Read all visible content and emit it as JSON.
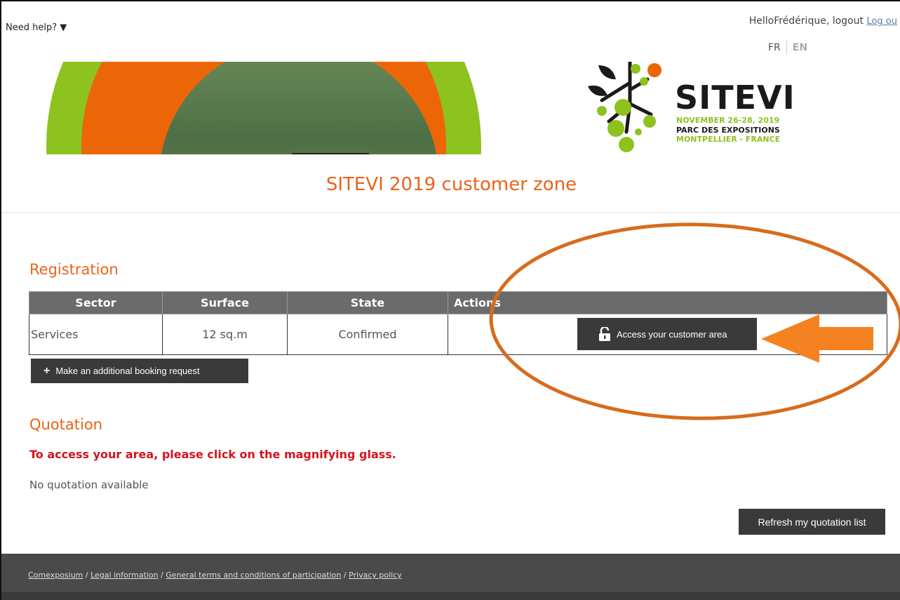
{
  "header": {
    "need_help": "Need help? ▼",
    "greeting": "HelloFrédérique, logout",
    "logout_link": "Log ou",
    "lang_fr": "FR",
    "lang_en": "EN"
  },
  "logo": {
    "name": "SITEVI",
    "line1": "NOVEMBER 26-28, 2019",
    "line2": "PARC DES EXPOSITIONS",
    "line3": "MONTPELLIER - FRANCE"
  },
  "page_title": "SITEVI 2019 customer zone",
  "registration": {
    "title": "Registration",
    "columns": [
      "Sector",
      "Surface",
      "State",
      "Actions"
    ],
    "row": {
      "sector": "Services",
      "surface": "12 sq.m",
      "state": "Confirmed"
    },
    "access_button": "Access your customer area",
    "booking_button": "Make an additional booking request"
  },
  "quotation": {
    "title": "Quotation",
    "notice": "To access your area, please click on the magnifying glass.",
    "empty": "No quotation available",
    "refresh_button": "Refresh my quotation list"
  },
  "footer": {
    "links": [
      "Comexposium",
      "Legal information",
      "General terms and conditions of participation",
      "Privacy policy"
    ]
  },
  "colors": {
    "accent_orange": "#e9631a",
    "brand_green": "#8dc21f",
    "notice_red": "#d4141c",
    "button_dark": "#3a3a3a"
  }
}
